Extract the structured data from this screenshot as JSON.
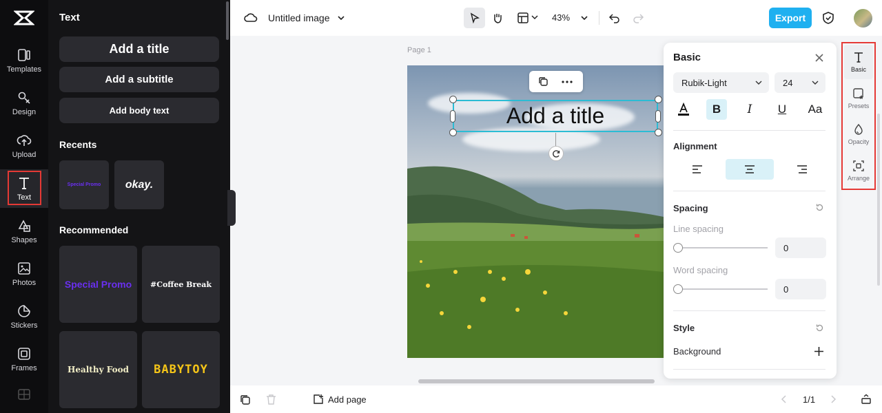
{
  "app": {
    "logo": "capcut-logo-icon"
  },
  "rail": {
    "items": [
      {
        "label": "Templates",
        "icon": "templates-icon"
      },
      {
        "label": "Design",
        "icon": "design-icon"
      },
      {
        "label": "Upload",
        "icon": "upload-icon"
      },
      {
        "label": "Text",
        "icon": "text-icon",
        "active": true
      },
      {
        "label": "Shapes",
        "icon": "shapes-icon"
      },
      {
        "label": "Photos",
        "icon": "photos-icon"
      },
      {
        "label": "Stickers",
        "icon": "stickers-icon"
      },
      {
        "label": "Frames",
        "icon": "frames-icon"
      }
    ]
  },
  "text_panel": {
    "title": "Text",
    "add_title": "Add a title",
    "add_subtitle": "Add a subtitle",
    "add_body": "Add body text",
    "recents_label": "Recents",
    "recents": [
      "Special Promo",
      "okay."
    ],
    "recommended_label": "Recommended",
    "recommended": [
      "Special Promo",
      "#Coffee Break",
      "Healthy Food",
      "BABYTOY"
    ]
  },
  "topbar": {
    "doc_title": "Untitled image",
    "zoom": "43%",
    "export_label": "Export"
  },
  "canvas": {
    "page_label": "Page 1",
    "selected_text": "Add a title"
  },
  "props": {
    "title": "Basic",
    "font": "Rubik-Light",
    "size": "24",
    "format": {
      "bold": "B",
      "italic": "I",
      "underline": "U",
      "case": "Aa"
    },
    "alignment_label": "Alignment",
    "spacing_label": "Spacing",
    "line_spacing_label": "Line spacing",
    "line_spacing_value": "0",
    "word_spacing_label": "Word spacing",
    "word_spacing_value": "0",
    "style_label": "Style",
    "background_label": "Background"
  },
  "right_tabs": [
    "Basic",
    "Presets",
    "Opacity",
    "Arrange"
  ],
  "bottombar": {
    "add_page": "Add page",
    "page_indicator": "1/1"
  },
  "colors": {
    "accent": "#1fb0f0",
    "selection": "#2bbcd4",
    "highlight_frame": "#e53935",
    "promo_purple": "#6a2ff0",
    "babytoy_yellow": "#f5c518"
  }
}
